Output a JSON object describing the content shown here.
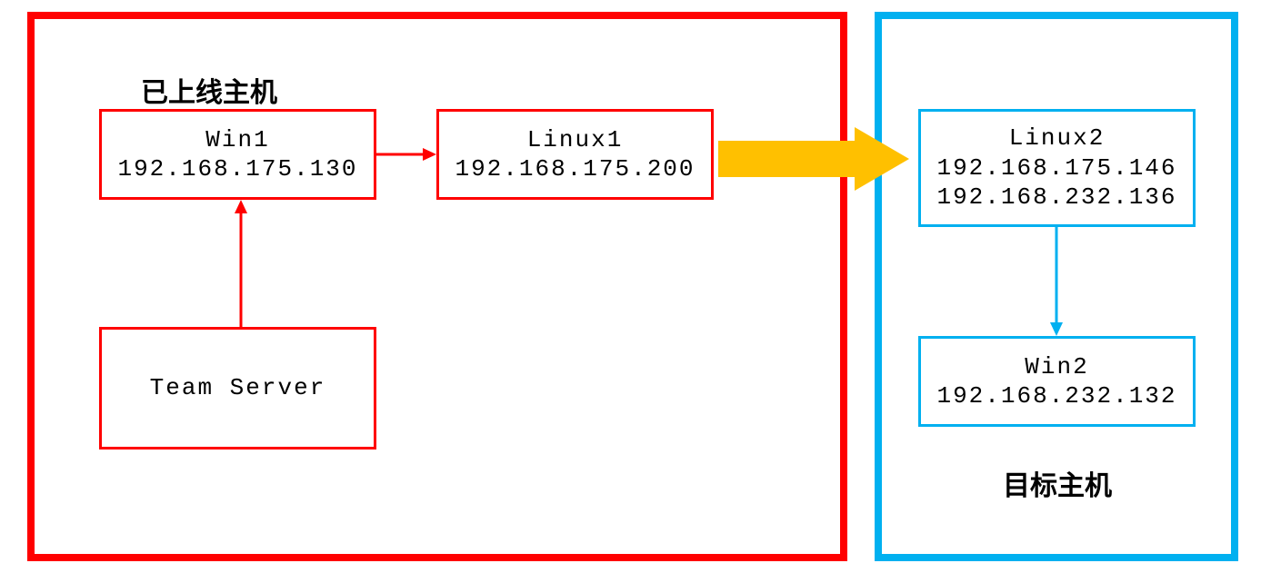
{
  "labels": {
    "online_hosts": "已上线主机",
    "target_hosts": "目标主机"
  },
  "nodes": {
    "win1": {
      "name": "Win1",
      "ip": "192.168.175.130"
    },
    "linux1": {
      "name": "Linux1",
      "ip": "192.168.175.200"
    },
    "team_server": {
      "name": "Team Server"
    },
    "linux2": {
      "name": "Linux2",
      "ip1": "192.168.175.146",
      "ip2": "192.168.232.136"
    },
    "win2": {
      "name": "Win2",
      "ip": "192.168.232.132"
    }
  },
  "colors": {
    "red": "#ff0000",
    "blue": "#00b0f0",
    "yellow": "#ffc000"
  }
}
